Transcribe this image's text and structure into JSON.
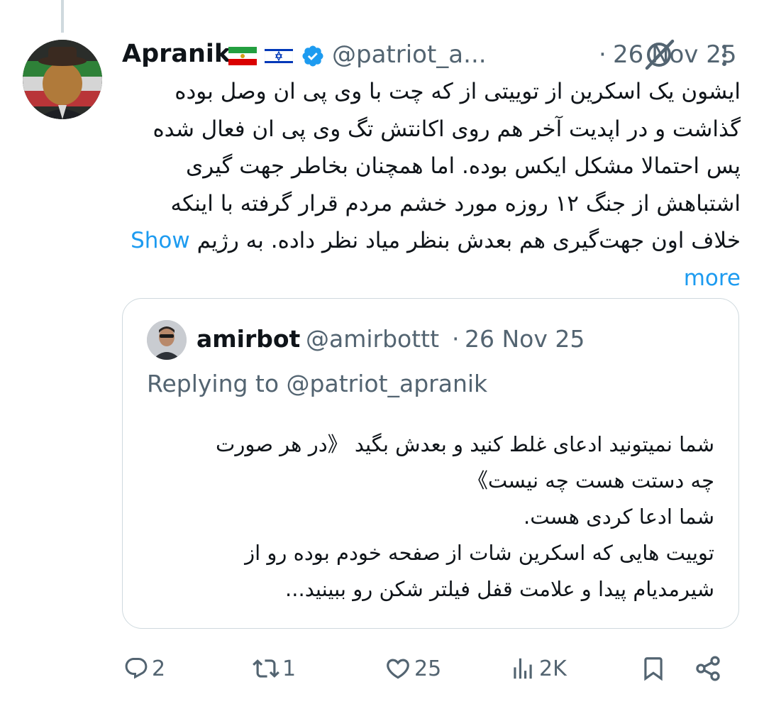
{
  "tweet": {
    "author_name": "Apranik",
    "flags": [
      "iran-lion-sun-flag",
      "israel-flag"
    ],
    "handle": "@patriot_a...",
    "separator": "·",
    "date": "26 Nov 25",
    "body_lines": [
      "ایشون یک اسکرین از توییتی از که چت با وی پی ان وصل بوده",
      "گذاشت و در اپدیت آخر هم روی اکانتش تگ وی پی ان فعال شده",
      "پس احتمالا مشکل ایکس بوده. اما همچنان بخاطر جهت گیری",
      "اشتباهش از جنگ ۱۲ روزه مورد خشم مردم قرار گرفته با اینکه",
      "خلاف اون جهت‌گیری هم بعدش بنظر میاد نظر داده. به رژیم"
    ],
    "show_more": "Show more"
  },
  "quote": {
    "author_name": "amirbot",
    "handle": "@amirbottt",
    "separator": "·",
    "date": "26 Nov 25",
    "replying_to": "Replying to @patriot_apranik",
    "body_lines": [
      "شما نمیتونید ادعای غلط کنید و بعدش بگید 《در هر صورت",
      "چه دستت هست چه نیست》",
      "شما ادعا کردی هست.",
      "توییت هایی که اسکرین شات از صفحه خودم بوده رو از",
      "شیرمدیام پیدا و علامت قفل فیلتر شکن رو ببینید..."
    ]
  },
  "actions": {
    "replies": "2",
    "reposts": "1",
    "likes": "25",
    "views": "2K"
  },
  "icons": {
    "verified": "verified-badge-icon",
    "grok": "grok-icon",
    "more": "more-options-icon",
    "reply": "reply-icon",
    "repost": "repost-icon",
    "like": "heart-icon",
    "views": "views-icon",
    "bookmark": "bookmark-icon",
    "share": "share-icon"
  },
  "colors": {
    "text": "#0f1419",
    "muted": "#536471",
    "link": "#1d9bf0",
    "border": "#cfd9de"
  }
}
